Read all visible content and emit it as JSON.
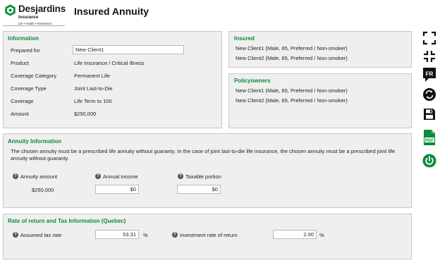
{
  "header": {
    "brand_name": "Desjardins",
    "brand_sub": "Insurance",
    "brand_tagline": "Life • Health • Retirement",
    "title": "Insured Annuity"
  },
  "information": {
    "title": "Information",
    "prepared_for_label": "Prepared for",
    "prepared_for_value": "New Client1",
    "rows": [
      {
        "label": "Product",
        "value": "Life Insurance / Critical Illness"
      },
      {
        "label": "Coverage Category",
        "value": "Permanent Life"
      },
      {
        "label": "Coverage Type",
        "value": "Joint Last-to-Die"
      },
      {
        "label": "Coverage",
        "value": "Life Term to 100"
      },
      {
        "label": "Amount",
        "value": "$250,000"
      }
    ]
  },
  "insured": {
    "title": "Insured",
    "items": [
      "New Client1 (Male, 65, Preferred / Non-smoker)",
      "New Client2 (Male, 65, Preferred / Non-smoker)"
    ]
  },
  "policyowners": {
    "title": "Policyowners",
    "items": [
      "New Client1 (Male, 65, Preferred / Non-smoker)",
      "New Client2 (Male, 65, Preferred / Non-smoker)"
    ]
  },
  "annuity": {
    "title": "Annuity Information",
    "description": "The chosen annuity must be a prescribed life annuity without guaranty. In the case of joint last-to-die life insurance, the chosen annuity must be a prescribed joint life annuity without guaranty.",
    "amount_label": "Annuity amount",
    "amount_value": "$250,000",
    "income_label": "Annual income",
    "income_value": "$0",
    "taxable_label": "Taxable portion",
    "taxable_value": "$0"
  },
  "rate": {
    "title": "Rate of return and Tax Information (Quebec)",
    "tax_label": "Assumed tax rate",
    "tax_value": "53.31",
    "tax_unit": "%",
    "return_label": "Investment rate of return",
    "return_value": "2.00",
    "return_unit": "%"
  },
  "toolbar": {
    "items": [
      "expand-icon",
      "collapse-icon",
      "fr-language-icon",
      "refresh-icon",
      "save-icon",
      "pdf-icon",
      "power-icon"
    ],
    "fr_label": "FR",
    "pdf_label": "PDF"
  },
  "colors": {
    "accent": "#0c8b3c",
    "panel_bg": "#efefef",
    "icon_dark": "#111111"
  }
}
